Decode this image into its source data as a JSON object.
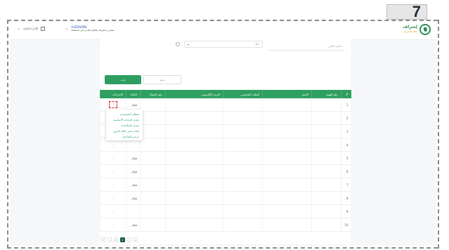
{
  "step_number": "7",
  "header": {
    "logo_title": "إشراف",
    "logo_subtitle": "نظام الإشراف",
    "user_name": "USERNAME",
    "user_role": "مشرف/مشرفة بقطاع تعليمي في المنطقة",
    "workspace_label": "الإدارة العامة"
  },
  "form": {
    "text_placeholder": "الاسم الثلاثي",
    "select_value": "الكل",
    "search_button": "بحث",
    "clear_button": "مسح"
  },
  "table": {
    "columns": [
      "#",
      "رقم الهوية",
      "الاسم",
      "الملف الشخصي",
      "البريد الإلكتروني",
      "رقم الجوال",
      "الحالة",
      "الإجراءات"
    ],
    "rows": [
      {
        "num": "1",
        "status": "فعال"
      },
      {
        "num": "2",
        "status": ""
      },
      {
        "num": "3",
        "status": ""
      },
      {
        "num": "4",
        "status": ""
      },
      {
        "num": "5",
        "status": "فعال"
      },
      {
        "num": "6",
        "status": "فعال"
      },
      {
        "num": "7",
        "status": "فعال"
      },
      {
        "num": "8",
        "status": "فعال"
      },
      {
        "num": "9",
        "status": ""
      },
      {
        "num": "10",
        "status": "فعال"
      }
    ]
  },
  "context_menu": {
    "items": [
      "تعطيل المستخدم",
      "تعديل البيانات الأساسية",
      "تعديل الصلاحيات",
      "إعادة تعيين كلمة المرور",
      "عرض التفاصيل"
    ]
  },
  "pagination": {
    "first": "«",
    "prev": "‹",
    "page_one": "1",
    "current": "2",
    "next": "›",
    "last": "»"
  }
}
